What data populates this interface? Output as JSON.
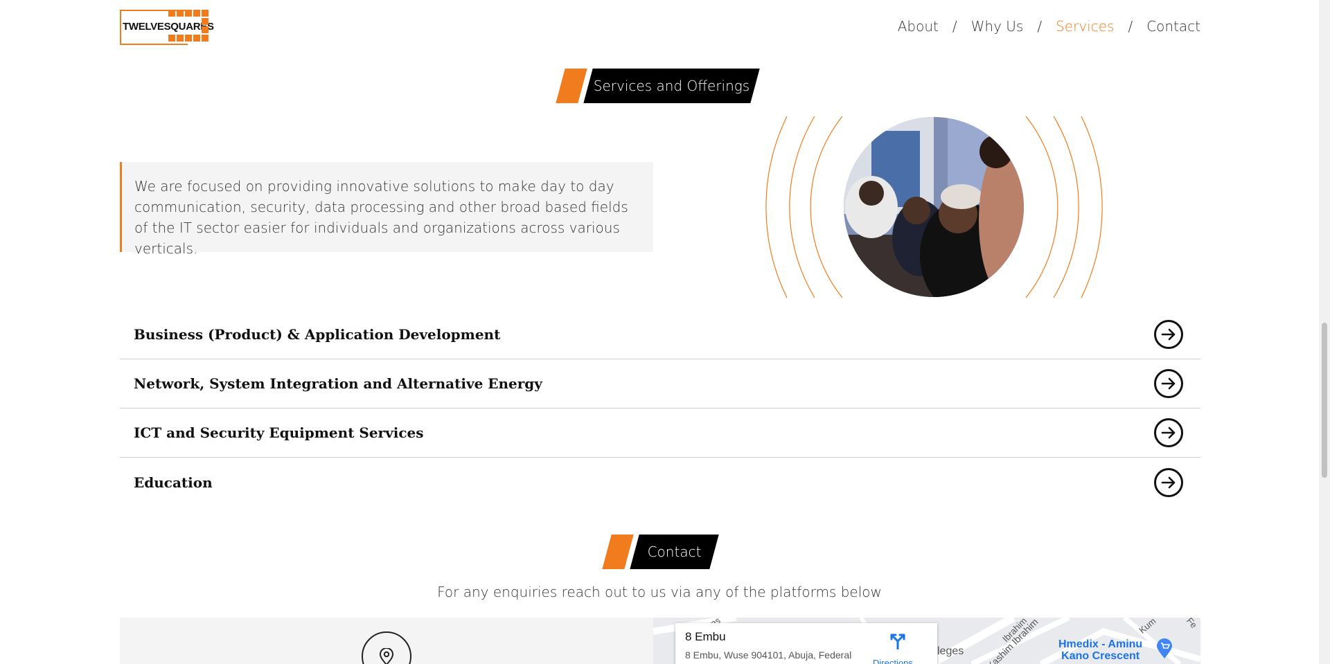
{
  "logo": {
    "text": "TWELVESQUARES"
  },
  "nav": {
    "items": [
      {
        "label": "About"
      },
      {
        "label": "Why Us"
      },
      {
        "label": "Services",
        "active": true
      },
      {
        "label": "Contact"
      }
    ],
    "separator": "/"
  },
  "services_section": {
    "badge": "Services and Offerings",
    "intro": "We are focused on providing innovative solutions to make day to day communication, security, data processing and other broad based fields of the IT sector easier for individuals and organizations across various verticals.",
    "items": [
      {
        "title": "Business (Product) & Application Development"
      },
      {
        "title": "Network, System Integration and Alternative Energy"
      },
      {
        "title": "ICT and Security Equipment Services"
      },
      {
        "title": "Education"
      }
    ]
  },
  "contact_section": {
    "badge": "Contact",
    "subtitle": "For any enquiries reach out to us via any of the platforms below"
  },
  "map": {
    "place_name": "8 Embu",
    "address": "8 Embu, Wuse 904101, Abuja, Federal",
    "directions_label": "Directions",
    "street_labels": [
      "Cres",
      "Ibrahim",
      "Kashim Ibrahim",
      "leges",
      "Kum",
      "Fe"
    ],
    "poi_label_line1": "Hmedix - Aminu",
    "poi_label_line2": "Kano Crescent"
  },
  "colors": {
    "accent": "#f07c1e",
    "dark": "#000000",
    "panel": "#f4f4f4",
    "link_blue": "#1a73e8"
  },
  "icons": {
    "service_arrow": "arrow-right-circle-icon",
    "location": "map-pin-icon",
    "directions": "directions-icon",
    "poi": "shopping-cart-pin-icon"
  }
}
